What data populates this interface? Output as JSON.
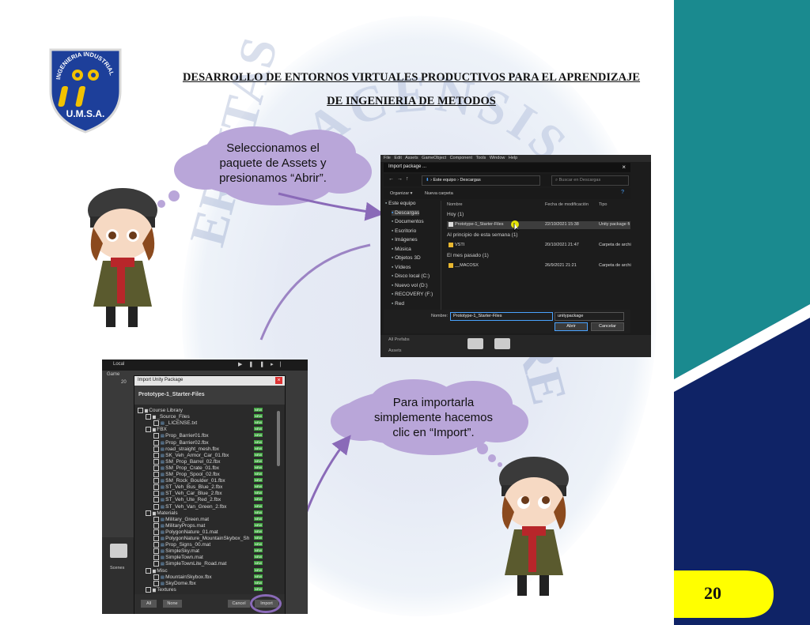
{
  "header": {
    "title_line1": "DESARROLLO DE ENTORNOS VIRTUALES PRODUCTIVOS PARA EL APRENDIZAJE",
    "title_line2": "DE INGENIERIA DE METODOS"
  },
  "logo": {
    "top_text": "INGENIERIA INDUSTRIAL",
    "bottom_text": "U.M.S.A."
  },
  "watermark": {
    "arc_text": "PACENSIS",
    "left_text": "ERSITAS",
    "right_text": "RE"
  },
  "cloud1": {
    "lines": [
      "Seleccionamos el",
      "paquete de Assets y",
      "presionamos “Abrir”."
    ]
  },
  "cloud2": {
    "lines": [
      "Para importarla",
      "simplemente hacemos",
      "clic en “Import”."
    ]
  },
  "page_number": "20",
  "colors": {
    "teal": "#1a8a8f",
    "navy": "#0f2366",
    "yellow": "#ffff00",
    "cloud": "#b9a6d9",
    "arrow": "#8a6ab8"
  },
  "file_dialog": {
    "menu": [
      "File",
      "Edit",
      "Assets",
      "GameObject",
      "Component",
      "Tools",
      "Window",
      "Help"
    ],
    "window_title": "Import package ...",
    "breadcrumb": [
      "Este equipo",
      "Descargas"
    ],
    "search_placeholder": "Buscar en Descargas",
    "toolbar": {
      "organize": "Organizar ▾",
      "new_folder": "Nueva carpeta"
    },
    "sidebar": [
      "Este equipo",
      "Descargas",
      "Documentos",
      "Escritorio",
      "Imágenes",
      "Música",
      "Objetos 3D",
      "Vídeos",
      "Disco local (C:)",
      "Nuevo vol (D:)",
      "RECOVERY (F:)",
      "Red"
    ],
    "columns": {
      "name": "Nombre",
      "date": "Fecha de modificación",
      "type": "Tipo"
    },
    "groups": [
      {
        "label": "Hoy (1)",
        "items": [
          {
            "name": "Prototype-1_Starter-Files",
            "date": "22/10/2021 15:38",
            "type": "Unity package fi"
          }
        ]
      },
      {
        "label": "Al principio de esta semana (1)",
        "items": [
          {
            "name": "VSTI",
            "date": "20/10/2021 21:47",
            "type": "Carpeta de archi"
          }
        ]
      },
      {
        "label": "El mes pasado (1)",
        "items": [
          {
            "name": "__MACOSX",
            "date": "26/9/2021 21:21",
            "type": "Carpeta de archi"
          }
        ]
      }
    ],
    "footer": {
      "name_label": "Nombre:",
      "name_value": "Prototype-1_Starter-Files",
      "filter_value": "unitypackage",
      "open": "Abrir",
      "cancel": "Cancelar"
    },
    "under": {
      "prefabs": "All Prefabs",
      "assets": "Assets"
    }
  },
  "unity_import": {
    "toolbar": {
      "local": "Local",
      "game": "Game",
      "scale": "20"
    },
    "window_title": "Import Unity Package",
    "package_name": "Prototype-1_Starter-Files",
    "tree": [
      {
        "label": "Course Library",
        "indent": 0,
        "folder": true
      },
      {
        "label": "_Source_Files",
        "indent": 1,
        "folder": true
      },
      {
        "label": "_LICENSE.txt",
        "indent": 2,
        "folder": false
      },
      {
        "label": "FBX",
        "indent": 1,
        "folder": true
      },
      {
        "label": "Prop_Barrier01.fbx",
        "indent": 2,
        "folder": false
      },
      {
        "label": "Prop_Barrier02.fbx",
        "indent": 2,
        "folder": false
      },
      {
        "label": "road_straight_mesh.fbx",
        "indent": 2,
        "folder": false
      },
      {
        "label": "SK_Veh_Armor_Car_01.fbx",
        "indent": 2,
        "folder": false
      },
      {
        "label": "SM_Prop_Barrel_02.fbx",
        "indent": 2,
        "folder": false
      },
      {
        "label": "SM_Prop_Crate_01.fbx",
        "indent": 2,
        "folder": false
      },
      {
        "label": "SM_Prop_Spool_02.fbx",
        "indent": 2,
        "folder": false
      },
      {
        "label": "SM_Rock_Boulder_01.fbx",
        "indent": 2,
        "folder": false
      },
      {
        "label": "ST_Veh_Bus_Blue_2.fbx",
        "indent": 2,
        "folder": false
      },
      {
        "label": "ST_Veh_Car_Blue_2.fbx",
        "indent": 2,
        "folder": false
      },
      {
        "label": "ST_Veh_Ute_Red_2.fbx",
        "indent": 2,
        "folder": false
      },
      {
        "label": "ST_Veh_Van_Green_2.fbx",
        "indent": 2,
        "folder": false
      },
      {
        "label": "Materials",
        "indent": 1,
        "folder": true
      },
      {
        "label": "Military_Green.mat",
        "indent": 2,
        "folder": false
      },
      {
        "label": "MilitaryProps.mat",
        "indent": 2,
        "folder": false
      },
      {
        "label": "PolygonNature_01.mat",
        "indent": 2,
        "folder": false
      },
      {
        "label": "PolygonNature_MountainSkybox_Sh",
        "indent": 2,
        "folder": false
      },
      {
        "label": "Prop_Signs_00.mat",
        "indent": 2,
        "folder": false
      },
      {
        "label": "SimpleSky.mat",
        "indent": 2,
        "folder": false
      },
      {
        "label": "SimpleTown.mat",
        "indent": 2,
        "folder": false
      },
      {
        "label": "SimpleTownLite_Road.mat",
        "indent": 2,
        "folder": false
      },
      {
        "label": "Misc",
        "indent": 1,
        "folder": true
      },
      {
        "label": "MountainSkybox.fbx",
        "indent": 2,
        "folder": false
      },
      {
        "label": "SkyDome.fbx",
        "indent": 2,
        "folder": false
      },
      {
        "label": "Textures",
        "indent": 1,
        "folder": true
      }
    ],
    "new_tag": "NEW",
    "buttons": {
      "all": "All",
      "none": "None",
      "cancel": "Cancel",
      "import": "Import"
    },
    "scenes_label": "Scenes"
  }
}
